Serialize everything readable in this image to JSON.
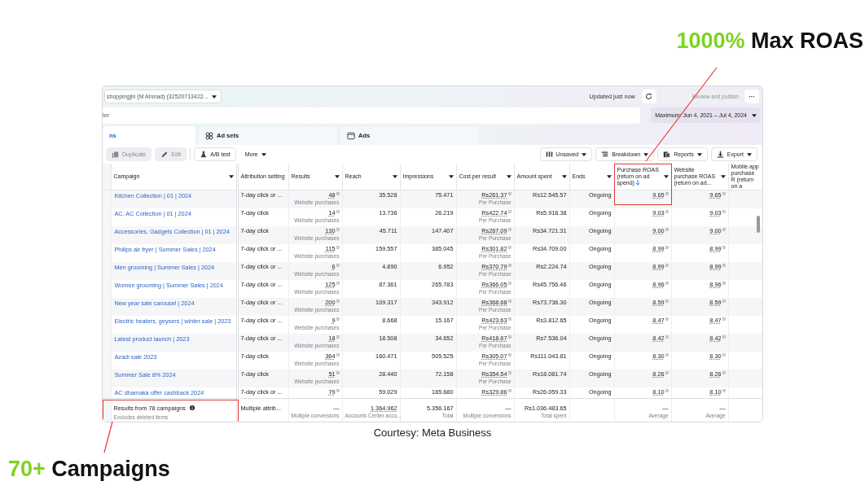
{
  "top_note": {
    "highlight": "1000%",
    "text": "Max ROAS"
  },
  "account": {
    "label": "shoppingjin (M Ahmad) (32520713422..."
  },
  "status": {
    "updated": "Updated just now",
    "publish": "Review and publish",
    "publish_disabled": true,
    "more": "···"
  },
  "search": {
    "value": "ter"
  },
  "date_range": "Maximum: Jun 4, 2021 – Jul 4, 2024",
  "tabs": [
    {
      "label": "ns",
      "selected": true
    },
    {
      "label": "Ad sets",
      "selected": false
    },
    {
      "label": "Ads",
      "selected": false
    }
  ],
  "toolbar_left": [
    {
      "label": "Duplicate",
      "disabled": true
    },
    {
      "label": "Edit",
      "disabled": true
    },
    {
      "label": "A/B test",
      "disabled": false
    },
    {
      "label": "More",
      "disabled": false
    }
  ],
  "toolbar_right": [
    {
      "label": "Unsaved"
    },
    {
      "label": "Breakdown"
    },
    {
      "label": "Reports"
    },
    {
      "label": "Export"
    }
  ],
  "columns": [
    {
      "label": "Campaign",
      "kind": "link",
      "caret": true,
      "sorted": false
    },
    {
      "label": "Attribution setting",
      "kind": "text",
      "caret": false,
      "sorted": false
    },
    {
      "label": "Results",
      "kind": "metric",
      "caret": true,
      "sorted": false
    },
    {
      "label": "Reach",
      "kind": "number",
      "caret": true,
      "sorted": false
    },
    {
      "label": "Impressions",
      "kind": "number",
      "caret": true,
      "sorted": false
    },
    {
      "label": "Cost per result",
      "kind": "metric",
      "caret": true,
      "sorted": false
    },
    {
      "label": "Amount spent",
      "kind": "number",
      "caret": true,
      "sorted": false
    },
    {
      "label": "Ends",
      "kind": "number",
      "caret": true,
      "sorted": false
    },
    {
      "label": "Purchase ROAS (return on ad spend)",
      "kind": "metric",
      "caret": true,
      "sorted": true
    },
    {
      "label": "Website purchase ROAS (return on ad...",
      "kind": "metric",
      "caret": true,
      "sorted": false
    },
    {
      "label": "Mobile app purchase R (return on a",
      "kind": "number",
      "caret": false,
      "sorted": false
    }
  ],
  "rows": [
    {
      "cells": [
        "Kitchen Collection | 01 | 2024",
        "7-day click or ...",
        {
          "text": "48",
          "sub": "Website purchases"
        },
        "35.528",
        "75.471",
        {
          "text": "Rs261.37",
          "sub": "Per Purchase"
        },
        "Rs12.545.57",
        "Ongoing",
        "9.65",
        "9.65"
      ]
    },
    {
      "cells": [
        "AC, AC Collection | 01 | 2024",
        "7-day click",
        {
          "text": "14",
          "sub": "Website purchases"
        },
        "13.736",
        "26.219",
        {
          "text": "Rs422.74",
          "sub": "Per Purchase"
        },
        "Rs5.918.38",
        "Ongoing",
        "9.03",
        "9.03"
      ]
    },
    {
      "cells": [
        "Accessories, Gadgets Collection | 01 | 2024",
        "7-day click",
        {
          "text": "130",
          "sub": "Website purchases"
        },
        "45.711",
        "147.407",
        {
          "text": "Rs267.09",
          "sub": "Per Purchase"
        },
        "Rs34.721.31",
        "Ongoing",
        "9.00",
        "9.00"
      ]
    },
    {
      "cells": [
        "Philips air fryer | Summer Sales | 2024",
        "7-day click or ...",
        {
          "text": "115",
          "sub": "Website purchases"
        },
        "159.557",
        "385.045",
        {
          "text": "Rs301.82",
          "sub": "Per Purchase"
        },
        "Rs34.709.00",
        "Ongoing",
        "8.99",
        "8.99"
      ]
    },
    {
      "cells": [
        "Men grooming | Summer Sales | 2024",
        "7-day click or ...",
        {
          "text": "6",
          "sub": "Website purchases"
        },
        "4.890",
        "6.952",
        {
          "text": "Rs370.79",
          "sub": "Per Purchase"
        },
        "Rs2.224.74",
        "Ongoing",
        "8.99",
        "8.99"
      ]
    },
    {
      "cells": [
        "Women grooming | Summer Sales | 2024",
        "7-day click or ...",
        {
          "text": "125",
          "sub": "Website purchases"
        },
        "87.361",
        "265.783",
        {
          "text": "Rs366.05",
          "sub": "Per Purchase"
        },
        "Rs45.756.46",
        "Ongoing",
        "8.96",
        "8.96"
      ]
    },
    {
      "cells": [
        "New year sale carousel | 2024",
        "7-day click or ...",
        {
          "text": "200",
          "sub": "Website purchases"
        },
        "109.317",
        "343.912",
        {
          "text": "Rs368.68",
          "sub": "Per Purchase"
        },
        "Rs73.736.30",
        "Ongoing",
        "8.59",
        "8.59"
      ]
    },
    {
      "cells": [
        "Electric heaters, geysers | winter sale | 2023",
        "7-day click or ...",
        {
          "text": "9",
          "sub": "Website purchases"
        },
        "8.668",
        "15.167",
        {
          "text": "Rs423.63",
          "sub": "Per Purchase"
        },
        "Rs3.812.65",
        "Ongoing",
        "8.47",
        "8.47"
      ]
    },
    {
      "cells": [
        "Latest product launch | 2023",
        "7-day click or ...",
        {
          "text": "18",
          "sub": "Website purchases"
        },
        "18.508",
        "34.652",
        {
          "text": "Rs418.67",
          "sub": "Per Purchase"
        },
        "Rs7.536.04",
        "Ongoing",
        "8.42",
        "8.42"
      ]
    },
    {
      "cells": [
        "Azadi sale 2023",
        "7-day click",
        {
          "text": "364",
          "sub": "Website purchases"
        },
        "160.471",
        "505.525",
        {
          "text": "Rs305.07",
          "sub": "Per Purchase"
        },
        "Rs111.043.81",
        "Ongoing",
        "8.30",
        "8.30"
      ]
    },
    {
      "cells": [
        "Summer Sale 8% 2024",
        "7-day click",
        {
          "text": "51",
          "sub": "Website purchases"
        },
        "28.440",
        "72.158",
        {
          "text": "Rs354.54",
          "sub": "Per Purchase"
        },
        "Rs18.081.74",
        "Ongoing",
        "8.26",
        "8.26"
      ]
    },
    {
      "cells": [
        "AC dhamaka offer cashback 2024",
        "7-day click or ...",
        "79",
        "59.029",
        "165.680",
        "Rs329.86",
        "Rs26.059.33",
        "Ongoing",
        "8.10",
        "8.10"
      ]
    }
  ],
  "footer": [
    {
      "text": "Results from 78 campaigns",
      "sub": "Excludes deleted items",
      "info": true,
      "kind": "title"
    },
    {
      "text": "Multiple attrib...",
      "kind": "text"
    },
    {
      "text": "—",
      "sub": "Multiple conversions",
      "kind": "number"
    },
    {
      "text": "1.364.962",
      "sub": "Accounts Center acco...",
      "kind": "metric"
    },
    {
      "text": "5.356.167",
      "sub": "Total",
      "kind": "number"
    },
    {
      "text": "—",
      "sub": "Multiple conversions",
      "kind": "number"
    },
    {
      "text": "Rs1.036.483.65",
      "sub": "Total spent",
      "kind": "number"
    },
    {
      "kind": "blank"
    },
    {
      "text": "—",
      "sub": "Average",
      "kind": "number"
    },
    {
      "text": "—",
      "sub": "Average",
      "kind": "number"
    }
  ],
  "caption": "Courtesy: Meta Business",
  "bottom_note": {
    "highlight": "70+",
    "text": "Campaigns"
  }
}
